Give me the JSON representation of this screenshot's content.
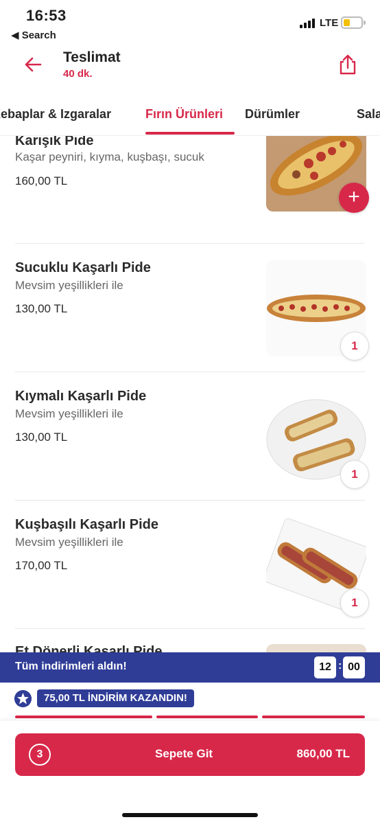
{
  "status_bar": {
    "time": "16:53",
    "back_app": "◀ Search",
    "network": "LTE"
  },
  "header": {
    "title": "Teslimat",
    "subtitle": "40 dk."
  },
  "tabs": [
    {
      "label": "Kebaplar & Izgaralar"
    },
    {
      "label": "Fırın Ürünleri",
      "active": true
    },
    {
      "label": "Dürümler"
    },
    {
      "label": "Salatalar"
    }
  ],
  "products": [
    {
      "name": "Karışık Pide",
      "desc": "Kaşar peyniri, kıyma, kuşbaşı, sucuk",
      "price": "160,00 TL",
      "action": "+"
    },
    {
      "name": "Sucuklu Kaşarlı Pide",
      "desc": "Mevsim yeşillikleri ile",
      "price": "130,00 TL",
      "qty": "1"
    },
    {
      "name": "Kıymalı Kaşarlı Pide",
      "desc": "Mevsim yeşillikleri ile",
      "price": "130,00 TL",
      "qty": "1"
    },
    {
      "name": "Kuşbaşılı Kaşarlı Pide",
      "desc": "Mevsim yeşillikleri ile",
      "price": "170,00 TL",
      "qty": "1"
    },
    {
      "name": "Et Dönerli Kaşarlı Pide"
    }
  ],
  "discount_banner": {
    "text": "Tüm indirimleri aldın!",
    "timer_min": "12",
    "timer_sep": ":",
    "timer_sec": "00"
  },
  "promo": {
    "text": "75,00 TL İNDİRİM KAZANDIN!"
  },
  "cart": {
    "count": "3",
    "label": "Sepete Git",
    "total": "860,00 TL"
  },
  "colors": {
    "primary": "#d7284a",
    "banner": "#2f3d97"
  }
}
